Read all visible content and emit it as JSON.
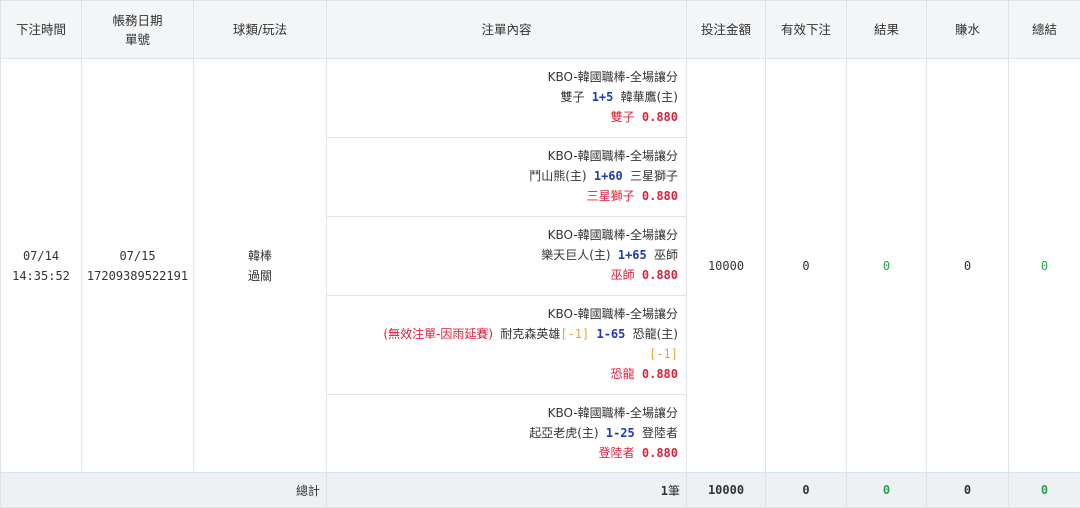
{
  "headers": {
    "bet_time": "下注時間",
    "acct_date": "帳務日期",
    "order_no": "單號",
    "sport_type": "球類/玩法",
    "bet_content": "注單內容",
    "amount": "投注金額",
    "valid_bet": "有效下注",
    "result": "結果",
    "win_loss": "賺水",
    "total": "總結"
  },
  "row": {
    "bet_date": "07/14",
    "bet_time": "14:35:52",
    "acct_date": "07/15",
    "order_no": "17209389522191",
    "sport": "韓棒",
    "play": "過關",
    "amount": "10000",
    "valid": "0",
    "result": "0",
    "win_loss": "0",
    "total": "0",
    "bets": [
      {
        "league": "KBO-韓國職棒-全場讓分",
        "home": "雙子",
        "handicap": "1+5",
        "away": "韓華鷹(主)",
        "pick": "雙子",
        "odds": "0.880"
      },
      {
        "league": "KBO-韓國職棒-全場讓分",
        "home": "鬥山熊(主)",
        "handicap": "1+60",
        "away": "三星獅子",
        "pick": "三星獅子",
        "odds": "0.880"
      },
      {
        "league": "KBO-韓國職棒-全場讓分",
        "home": "樂天巨人(主)",
        "handicap": "1+65",
        "away": "巫師",
        "pick": "巫師",
        "odds": "0.880"
      },
      {
        "league": "KBO-韓國職棒-全場讓分",
        "invalid_note": "(無效注單-因雨延賽)",
        "home": "耐克森英雄",
        "home_mark": "[-1]",
        "handicap": "1-65",
        "away": "恐龍(主)",
        "away_mark": "[-1]",
        "pick": "恐龍",
        "odds": "0.880"
      },
      {
        "league": "KBO-韓國職棒-全場讓分",
        "home": "起亞老虎(主)",
        "handicap": "1-25",
        "away": "登陸者",
        "pick": "登陸者",
        "odds": "0.880"
      }
    ]
  },
  "footer": {
    "label": "總計",
    "count": "1",
    "count_unit": "筆",
    "amount": "10000",
    "valid": "0",
    "result": "0",
    "win_loss": "0",
    "total": "0"
  },
  "colors": {
    "handicap": "#1f3bb8",
    "pick_red": "#e0213a",
    "bracket_orange": "#f0a030",
    "positive_green": "#27a24a",
    "header_bg": "#f3f5f7"
  }
}
